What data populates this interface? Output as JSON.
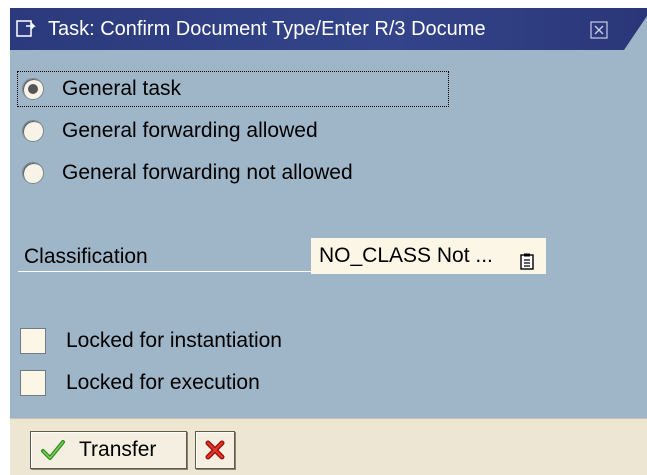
{
  "window": {
    "title": "Task: Confirm Document Type/Enter R/3 Docume",
    "icons": {
      "title": "task-window-icon",
      "close": "close-icon"
    }
  },
  "options": {
    "radios": [
      {
        "label": "General task",
        "selected": true
      },
      {
        "label": "General forwarding allowed",
        "selected": false
      },
      {
        "label": "General forwarding not allowed",
        "selected": false
      }
    ]
  },
  "classification": {
    "label": "Classification",
    "value": "NO_CLASS Not ...",
    "icon": "value-help-icon"
  },
  "locks": {
    "items": [
      {
        "label": "Locked for instantiation",
        "checked": false
      },
      {
        "label": "Locked for execution",
        "checked": false
      }
    ]
  },
  "footer": {
    "transfer_label": "Transfer",
    "transfer_icon": "check-icon",
    "cancel_icon": "cancel-x-icon"
  },
  "colors": {
    "window_bg": "#9fb6c8",
    "titlebar": "#2f3e7e",
    "field_bg": "#fbf6e6",
    "footer_bg": "#ece6d3"
  }
}
